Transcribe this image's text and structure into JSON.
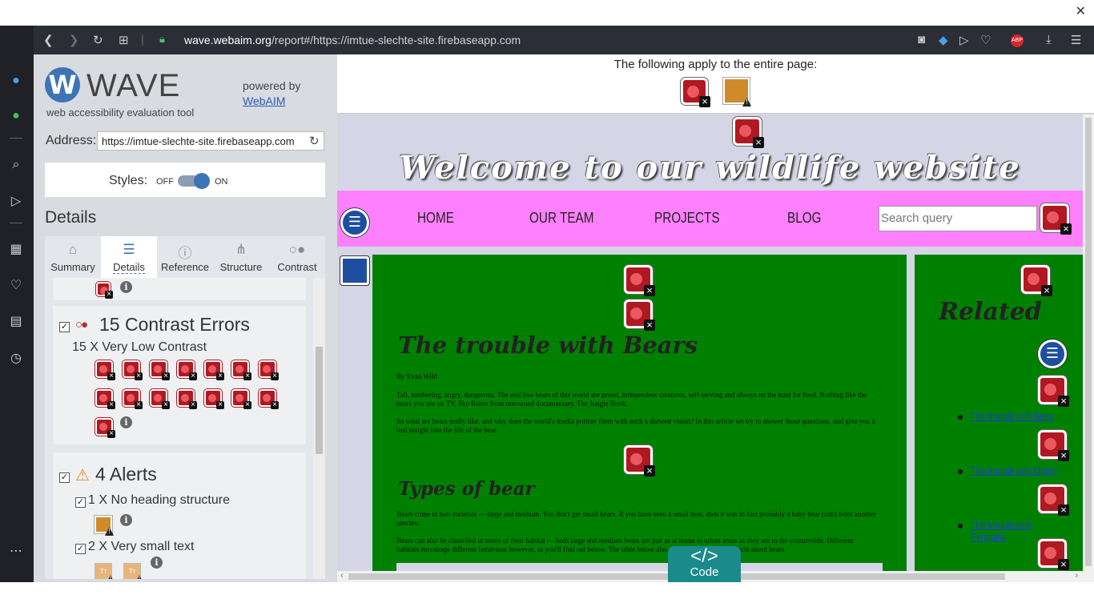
{
  "browser": {
    "url_domain": "wave.webaim.org",
    "url_rest": "/report#/https://imtue-slechte-site.firebaseapp.com"
  },
  "wave": {
    "logo_letter": "W",
    "logo_text": "WAVE",
    "subtitle": "web accessibility evaluation tool",
    "powered_by": "powered by",
    "powered_link": "WebAIM",
    "address_label": "Address:",
    "address_value": "https://imtue-slechte-site.firebaseapp.com",
    "styles_label": "Styles:",
    "styles_off": "OFF",
    "styles_on": "ON",
    "details_heading": "Details",
    "tabs": [
      {
        "label": "Summary",
        "icon": "home-icon"
      },
      {
        "label": "Details",
        "icon": "list-icon"
      },
      {
        "label": "Reference",
        "icon": "info-icon"
      },
      {
        "label": "Structure",
        "icon": "sitemap-icon"
      },
      {
        "label": "Contrast",
        "icon": "contrast-icon"
      }
    ],
    "contrast": {
      "title": "15 Contrast Errors",
      "item_label": "15 X Very Low Contrast"
    },
    "alerts": {
      "title": "4 Alerts",
      "item1": "1 X No heading structure",
      "item2": "2 X Very small text",
      "small_text_glyph": "Tт"
    }
  },
  "preview": {
    "apply_text": "The following apply to the entire page:",
    "welcome": "Welcome to our wildlife website",
    "nav": [
      "HOME",
      "OUR TEAM",
      "PROJECTS",
      "BLOG"
    ],
    "search_placeholder": "Search query",
    "main_heading": "The trouble with Bears",
    "byline": "By Evan Wild",
    "para1": "Tall, lumbering, angry, dangerous. The real live bears of this world are proud, independent creatures, self-serving and always on the hunt for food. Nothing like the bears you see on TV, like Baloo from renowned documentary, The Jungle Book.",
    "para2": "So what are bears really like, and why does the world's media portray them with such a skewed vision? In this article we try to answer those questions, and give you a real insight into the life of the bear.",
    "sub_heading": "Types of bear",
    "para3": "Bears come in two varieties — large and medium. You don't get small bears. If you have seen a small bear, then it was in fact probably a baby bear (cub) from another species.",
    "para4": "Bears can also be classified in terms of their habitat — both large and medium bears are just as at home in urban areas as they are in the countryside. Different habitats encourage different behaviour however, as you'll find out below. The table below also gives you some useful facts about bears.",
    "related_heading": "Related",
    "related_links": [
      "The trouble with Bees",
      "The trouble with Otters",
      "The trouble with Penguins"
    ],
    "code_glyph": "</>",
    "code_label": "Code"
  }
}
